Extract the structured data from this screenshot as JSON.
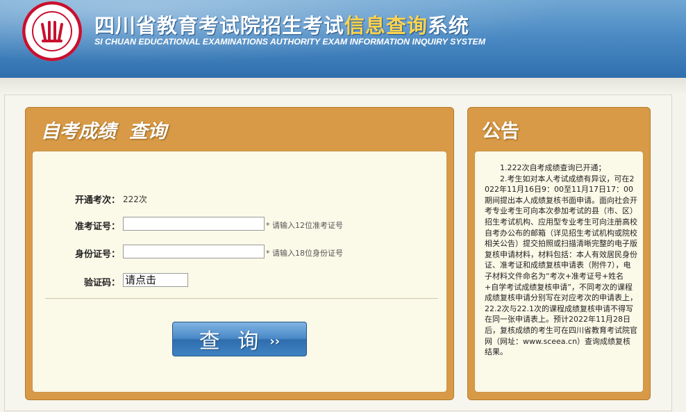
{
  "header": {
    "title_part1": "四川省教育考试院招生考试",
    "title_highlight": "信息查询",
    "title_part2": "系统",
    "subtitle": "SI CHUAN EDUCATIONAL EXAMINATIONS AUTHORITY EXAM INFORMATION INQUIRY SYSTEM",
    "logo_icon": "sceea-seal-logo",
    "logo_color": "#c8102e"
  },
  "query_panel": {
    "title": "自考成绩  查询",
    "session_label": "开通考次：",
    "session_value": "222次",
    "exam_id_label": "准考证号：",
    "exam_id_value": "",
    "exam_id_hint": "* 请输入12位准考证号",
    "id_card_label": "身份证号：",
    "id_card_value": "",
    "id_card_hint": "* 请输入18位身份证号",
    "captcha_label": "验证码：",
    "captcha_text": "请点击",
    "query_button_label": "查 询",
    "query_button_arrows": "››"
  },
  "notice_panel": {
    "title": "公告",
    "items": [
      "1.222次自考成绩查询已开通；",
      "2.考生如对本人考试成绩有异议，可在2022年11月16日9：00至11月17日17：00期间提出本人成绩复核书面申请。面向社会开考专业考生可向本次参加考试的县（市、区）招生考试机构、应用型专业考生可向注册高校自考办公布的邮箱（详见招生考试机构或院校相关公告）提交拍照或扫描清晰完整的电子版复核申请材料，材料包括：本人有效居民身份证、准考证和成绩复核申请表（附件7），电子材料文件命名为“考次+准考证号+姓名+自学考试成绩复核申请”，不同考次的课程成绩复核申请分别写在对应考次的申请表上，22.2次与22.1次的课程成绩复核申请不得写在同一张申请表上。预计2022年11月28日后，复核成绩的考生可在四川省教育考试院官网（网址：www.sceea.cn）查询成绩复核结果。"
    ]
  },
  "colors": {
    "header_blue": "#4c8bc4",
    "title_highlight": "#ffd34d",
    "panel_orange": "#d89a46",
    "panel_body": "#fbf9e8",
    "button_blue": "#3f82c2"
  }
}
